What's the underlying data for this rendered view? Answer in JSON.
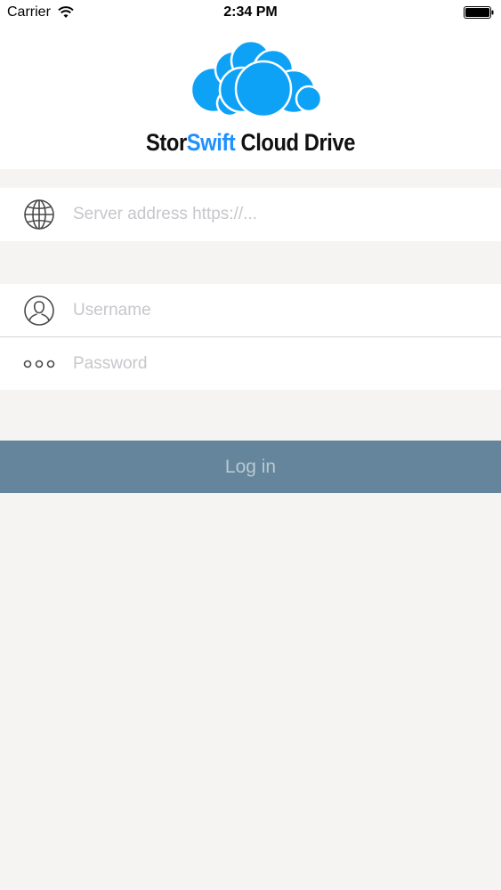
{
  "status_bar": {
    "carrier": "Carrier",
    "time": "2:34 PM"
  },
  "logo": {
    "part1": "Stor",
    "part2": "Swift",
    "part3": " Cloud Drive",
    "accent_color": "#1e90ff"
  },
  "form": {
    "server": {
      "placeholder": "Server address https://...",
      "value": "",
      "icon": "globe-icon"
    },
    "username": {
      "placeholder": "Username",
      "value": "",
      "icon": "user-icon"
    },
    "password": {
      "placeholder": "Password",
      "value": "",
      "icon": "password-dots-icon"
    },
    "login_label": "Log in",
    "login_button_color": "#64859b"
  }
}
